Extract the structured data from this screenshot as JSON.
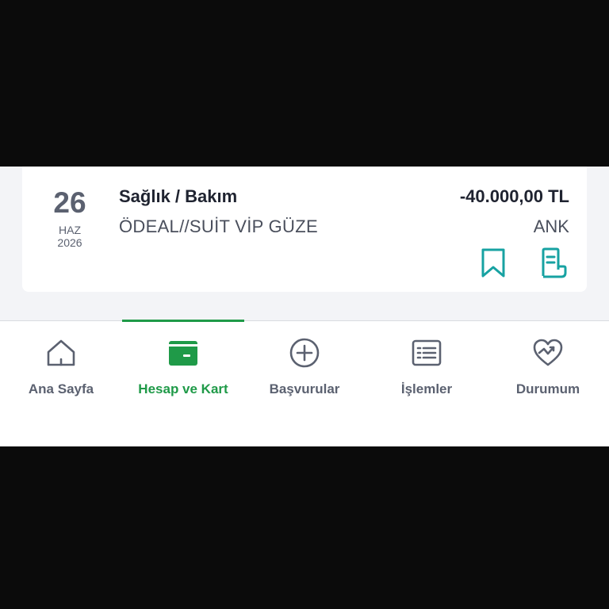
{
  "colors": {
    "accent": "#1f9a48",
    "action_teal": "#17a2a2",
    "text_primary": "#1f2330",
    "text_secondary": "#5b6170"
  },
  "transaction": {
    "day": "26",
    "month": "HAZ",
    "year": "2026",
    "category": "Sağlık / Bakım",
    "description": "ÖDEAL//SUİT VİP GÜZE",
    "amount": "-40.000,00 TL",
    "city": "ANK",
    "actions": [
      {
        "icon": "bookmark-icon"
      },
      {
        "icon": "receipt-icon"
      }
    ]
  },
  "tabbar": {
    "active_index": 1,
    "tabs": [
      {
        "label": "Ana Sayfa",
        "icon": "home-icon"
      },
      {
        "label": "Hesap ve Kart",
        "icon": "wallet-icon"
      },
      {
        "label": "Başvurular",
        "icon": "plus-circle-icon"
      },
      {
        "label": "İşlemler",
        "icon": "list-icon"
      },
      {
        "label": "Durumum",
        "icon": "heart-chart-icon"
      }
    ]
  }
}
